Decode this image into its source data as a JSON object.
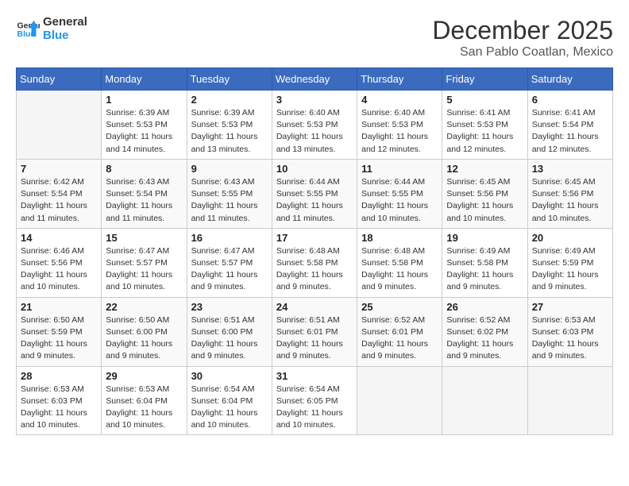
{
  "logo": {
    "text1": "General",
    "text2": "Blue"
  },
  "title": "December 2025",
  "subtitle": "San Pablo Coatlan, Mexico",
  "headers": [
    "Sunday",
    "Monday",
    "Tuesday",
    "Wednesday",
    "Thursday",
    "Friday",
    "Saturday"
  ],
  "weeks": [
    [
      {
        "day": "",
        "info": ""
      },
      {
        "day": "1",
        "info": "Sunrise: 6:39 AM\nSunset: 5:53 PM\nDaylight: 11 hours\nand 14 minutes."
      },
      {
        "day": "2",
        "info": "Sunrise: 6:39 AM\nSunset: 5:53 PM\nDaylight: 11 hours\nand 13 minutes."
      },
      {
        "day": "3",
        "info": "Sunrise: 6:40 AM\nSunset: 5:53 PM\nDaylight: 11 hours\nand 13 minutes."
      },
      {
        "day": "4",
        "info": "Sunrise: 6:40 AM\nSunset: 5:53 PM\nDaylight: 11 hours\nand 12 minutes."
      },
      {
        "day": "5",
        "info": "Sunrise: 6:41 AM\nSunset: 5:53 PM\nDaylight: 11 hours\nand 12 minutes."
      },
      {
        "day": "6",
        "info": "Sunrise: 6:41 AM\nSunset: 5:54 PM\nDaylight: 11 hours\nand 12 minutes."
      }
    ],
    [
      {
        "day": "7",
        "info": "Sunrise: 6:42 AM\nSunset: 5:54 PM\nDaylight: 11 hours\nand 11 minutes."
      },
      {
        "day": "8",
        "info": "Sunrise: 6:43 AM\nSunset: 5:54 PM\nDaylight: 11 hours\nand 11 minutes."
      },
      {
        "day": "9",
        "info": "Sunrise: 6:43 AM\nSunset: 5:55 PM\nDaylight: 11 hours\nand 11 minutes."
      },
      {
        "day": "10",
        "info": "Sunrise: 6:44 AM\nSunset: 5:55 PM\nDaylight: 11 hours\nand 11 minutes."
      },
      {
        "day": "11",
        "info": "Sunrise: 6:44 AM\nSunset: 5:55 PM\nDaylight: 11 hours\nand 10 minutes."
      },
      {
        "day": "12",
        "info": "Sunrise: 6:45 AM\nSunset: 5:56 PM\nDaylight: 11 hours\nand 10 minutes."
      },
      {
        "day": "13",
        "info": "Sunrise: 6:45 AM\nSunset: 5:56 PM\nDaylight: 11 hours\nand 10 minutes."
      }
    ],
    [
      {
        "day": "14",
        "info": "Sunrise: 6:46 AM\nSunset: 5:56 PM\nDaylight: 11 hours\nand 10 minutes."
      },
      {
        "day": "15",
        "info": "Sunrise: 6:47 AM\nSunset: 5:57 PM\nDaylight: 11 hours\nand 10 minutes."
      },
      {
        "day": "16",
        "info": "Sunrise: 6:47 AM\nSunset: 5:57 PM\nDaylight: 11 hours\nand 9 minutes."
      },
      {
        "day": "17",
        "info": "Sunrise: 6:48 AM\nSunset: 5:58 PM\nDaylight: 11 hours\nand 9 minutes."
      },
      {
        "day": "18",
        "info": "Sunrise: 6:48 AM\nSunset: 5:58 PM\nDaylight: 11 hours\nand 9 minutes."
      },
      {
        "day": "19",
        "info": "Sunrise: 6:49 AM\nSunset: 5:58 PM\nDaylight: 11 hours\nand 9 minutes."
      },
      {
        "day": "20",
        "info": "Sunrise: 6:49 AM\nSunset: 5:59 PM\nDaylight: 11 hours\nand 9 minutes."
      }
    ],
    [
      {
        "day": "21",
        "info": "Sunrise: 6:50 AM\nSunset: 5:59 PM\nDaylight: 11 hours\nand 9 minutes."
      },
      {
        "day": "22",
        "info": "Sunrise: 6:50 AM\nSunset: 6:00 PM\nDaylight: 11 hours\nand 9 minutes."
      },
      {
        "day": "23",
        "info": "Sunrise: 6:51 AM\nSunset: 6:00 PM\nDaylight: 11 hours\nand 9 minutes."
      },
      {
        "day": "24",
        "info": "Sunrise: 6:51 AM\nSunset: 6:01 PM\nDaylight: 11 hours\nand 9 minutes."
      },
      {
        "day": "25",
        "info": "Sunrise: 6:52 AM\nSunset: 6:01 PM\nDaylight: 11 hours\nand 9 minutes."
      },
      {
        "day": "26",
        "info": "Sunrise: 6:52 AM\nSunset: 6:02 PM\nDaylight: 11 hours\nand 9 minutes."
      },
      {
        "day": "27",
        "info": "Sunrise: 6:53 AM\nSunset: 6:03 PM\nDaylight: 11 hours\nand 9 minutes."
      }
    ],
    [
      {
        "day": "28",
        "info": "Sunrise: 6:53 AM\nSunset: 6:03 PM\nDaylight: 11 hours\nand 10 minutes."
      },
      {
        "day": "29",
        "info": "Sunrise: 6:53 AM\nSunset: 6:04 PM\nDaylight: 11 hours\nand 10 minutes."
      },
      {
        "day": "30",
        "info": "Sunrise: 6:54 AM\nSunset: 6:04 PM\nDaylight: 11 hours\nand 10 minutes."
      },
      {
        "day": "31",
        "info": "Sunrise: 6:54 AM\nSunset: 6:05 PM\nDaylight: 11 hours\nand 10 minutes."
      },
      {
        "day": "",
        "info": ""
      },
      {
        "day": "",
        "info": ""
      },
      {
        "day": "",
        "info": ""
      }
    ]
  ]
}
